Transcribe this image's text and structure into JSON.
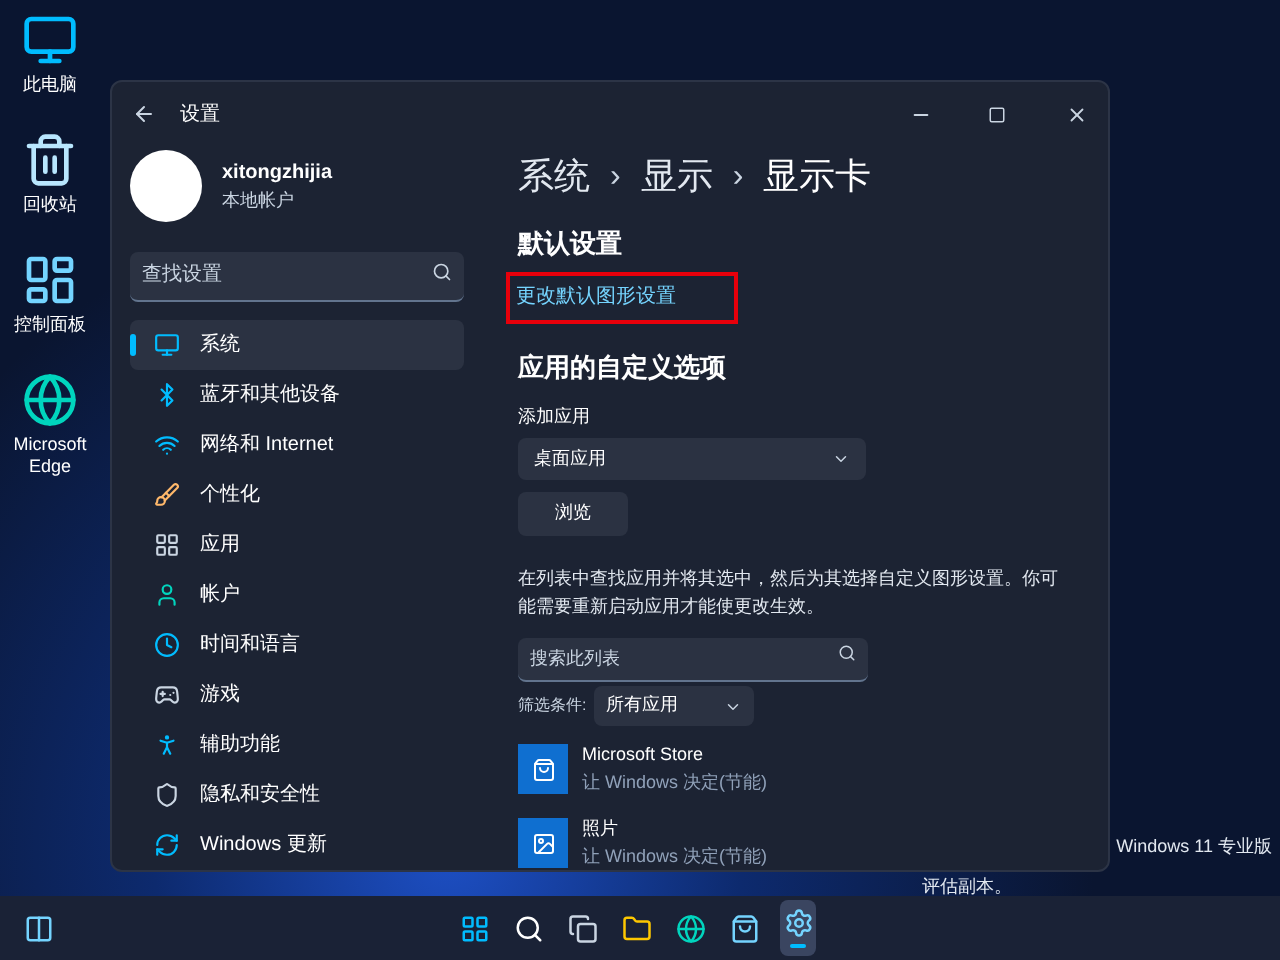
{
  "desktop_icons": [
    {
      "label": "此电脑",
      "kind": "pc"
    },
    {
      "label": "回收站",
      "kind": "bin"
    },
    {
      "label": "控制面板",
      "kind": "panel"
    },
    {
      "label": "Microsoft Edge",
      "kind": "edge"
    }
  ],
  "window": {
    "title": "设置",
    "account": {
      "name": "xitongzhijia",
      "type": "本地帐户"
    },
    "search": {
      "placeholder": "查找设置"
    },
    "nav": [
      {
        "label": "系统",
        "selected": true,
        "kind": "system"
      },
      {
        "label": "蓝牙和其他设备",
        "selected": false,
        "kind": "bluetooth"
      },
      {
        "label": "网络和 Internet",
        "selected": false,
        "kind": "network"
      },
      {
        "label": "个性化",
        "selected": false,
        "kind": "personalize"
      },
      {
        "label": "应用",
        "selected": false,
        "kind": "apps"
      },
      {
        "label": "帐户",
        "selected": false,
        "kind": "account"
      },
      {
        "label": "时间和语言",
        "selected": false,
        "kind": "time"
      },
      {
        "label": "游戏",
        "selected": false,
        "kind": "gaming"
      },
      {
        "label": "辅助功能",
        "selected": false,
        "kind": "accessibility"
      },
      {
        "label": "隐私和安全性",
        "selected": false,
        "kind": "privacy"
      },
      {
        "label": "Windows 更新",
        "selected": false,
        "kind": "update"
      }
    ],
    "breadcrumb": [
      {
        "text": "系统",
        "kind": "crumb"
      },
      {
        "text": "›",
        "kind": "separator"
      },
      {
        "text": "显示",
        "kind": "crumb"
      },
      {
        "text": "›",
        "kind": "separator"
      },
      {
        "text": "显示卡",
        "kind": "current"
      }
    ],
    "default_settings": {
      "heading": "默认设置",
      "link": "更改默认图形设置",
      "highlighted": true
    },
    "custom": {
      "heading": "应用的自定义选项",
      "add_label": "添加应用",
      "add_value": "桌面应用",
      "browse": "浏览",
      "description": "在列表中查找应用并将其选中，然后为其选择自定义图形设置。你可能需要重新启动应用才能使更改生效。",
      "search_placeholder": "搜索此列表",
      "filter_label": "筛选条件:",
      "filter_value": "所有应用"
    },
    "apps": [
      {
        "name": "Microsoft Store",
        "setting": "让 Windows 决定(节能)",
        "kind": "store"
      },
      {
        "name": "照片",
        "setting": "让 Windows 决定(节能)",
        "kind": "photos"
      }
    ]
  },
  "desktop_text": [
    "Windows 11 专业版",
    "评估副本。"
  ],
  "taskbar": [
    {
      "kind": "widgets"
    },
    {
      "kind": "start",
      "active": false
    },
    {
      "kind": "search",
      "active": false
    },
    {
      "kind": "taskview",
      "active": false
    },
    {
      "kind": "explorer",
      "active": false
    },
    {
      "kind": "edge",
      "active": false
    },
    {
      "kind": "store",
      "active": false
    },
    {
      "kind": "settings",
      "active": true
    }
  ]
}
